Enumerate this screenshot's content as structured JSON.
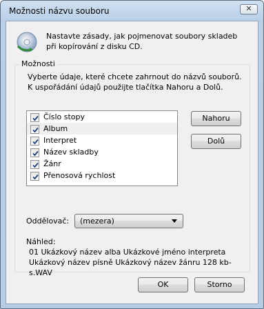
{
  "window": {
    "title": "Možnosti názvu souboru",
    "close_glyph": "✕"
  },
  "intro": {
    "text": "Nastavte zásady, jak pojmenovat soubory skladeb při kopírování z disku CD."
  },
  "options": {
    "legend": "Možnosti",
    "description_line1": "Vyberte údaje, které chcete zahrnout do názvů souborů.",
    "description_line2": "K uspořádání údajů použijte tlačítka Nahoru a Dolů.",
    "items": [
      {
        "label": "Číslo stopy",
        "checked": true
      },
      {
        "label": "Album",
        "checked": true
      },
      {
        "label": "Interpret",
        "checked": true
      },
      {
        "label": "Název skladby",
        "checked": true
      },
      {
        "label": "Žánr",
        "checked": true
      },
      {
        "label": "Přenosová rychlost",
        "checked": true
      }
    ],
    "up_label": "Nahoru",
    "down_label": "Dolů",
    "separator_label": "Oddělovač:",
    "separator_value": "(mezera)",
    "preview_label": "Náhled:",
    "preview_line1": "01 Ukázkový název alba Ukázkové jméno interpreta",
    "preview_line2": "Ukázkový název písně Ukázkový název žánru 128 kb-s.WAV"
  },
  "footer": {
    "ok_label": "OK",
    "cancel_label": "Storno"
  },
  "icons": {
    "window": "cd-icon",
    "checkbox": "checkmark-icon",
    "dropdown": "chevron-down-icon",
    "close": "close-icon"
  }
}
